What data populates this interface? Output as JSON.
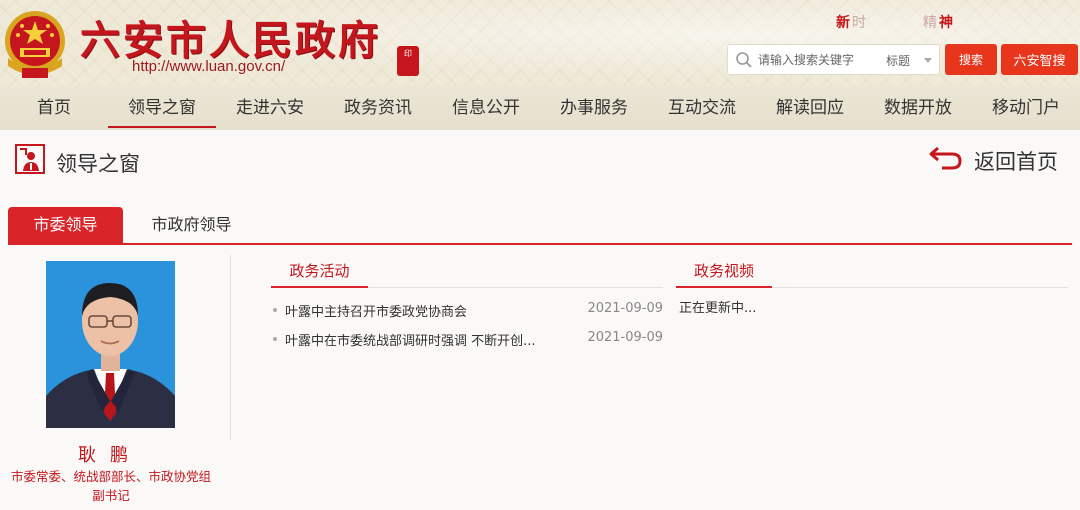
{
  "header": {
    "site_title": "六安市人民政府",
    "site_url": "http://www.luan.gov.cn/",
    "seal_text": "印",
    "motto_part1": "新",
    "motto_part2": "时",
    "motto_part3": "精",
    "motto_part4": "神"
  },
  "search": {
    "placeholder": "请输入搜索关键字",
    "scope": "标题",
    "button_label": "搜索",
    "smart_label": "六安智搜"
  },
  "nav": {
    "items": [
      "首页",
      "领导之窗",
      "走进六安",
      "政务资讯",
      "信息公开",
      "办事服务",
      "互动交流",
      "解读回应",
      "数据开放",
      "移动门户"
    ],
    "active_index": 1
  },
  "section": {
    "title": "领导之窗",
    "back_label": "返回首页"
  },
  "tabs": {
    "committee": "市委领导",
    "government": "市政府领导"
  },
  "leader": {
    "name": "耿鹏",
    "title": "市委常委、统战部部长、市政协党组副书记"
  },
  "activities": {
    "title": "政务活动",
    "items": [
      {
        "text": "叶露中主持召开市委政党协商会",
        "date": "2021-09-09"
      },
      {
        "text": "叶露中在市委统战部调研时强调 不断开创...",
        "date": "2021-09-09"
      }
    ]
  },
  "videos": {
    "title": "政务视频",
    "status": "正在更新中..."
  },
  "colors": {
    "brand_red": "#c4161c",
    "button_red": "#e8361d",
    "header_bg": "#efe9d8"
  }
}
